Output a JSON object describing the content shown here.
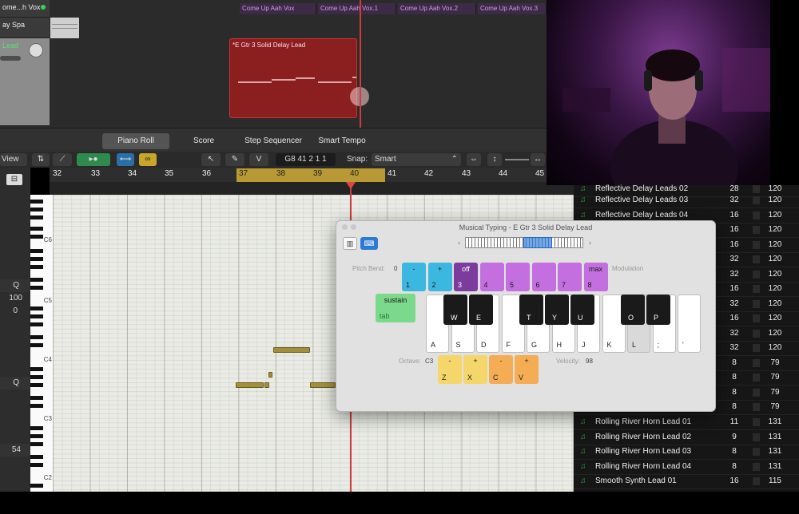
{
  "arrange": {
    "tracks": [
      {
        "name": "ome...h Vox"
      },
      {
        "name": "ay Spa"
      },
      {
        "name": "Lead"
      }
    ],
    "top_regions": [
      {
        "label": "Come Up Aah Vox"
      },
      {
        "label": "Come Up Aah Vox.1"
      },
      {
        "label": "Come Up Aah Vox.2"
      },
      {
        "label": "Come Up Aah Vox.3"
      }
    ],
    "red_region": {
      "label": "*E Gtr 3 Solid Delay Lead"
    }
  },
  "tabs": [
    {
      "label": "Piano Roll"
    },
    {
      "label": "Score"
    },
    {
      "label": "Step Sequencer"
    },
    {
      "label": "Smart Tempo"
    }
  ],
  "toolbar": {
    "view_label": "View",
    "lcd": "G8   41 2 1 1",
    "snap_label": "Snap:",
    "snap_value": "Smart",
    "v_label": "V"
  },
  "ruler": {
    "bars": [
      "32",
      "33",
      "34",
      "35",
      "36",
      "37",
      "38",
      "39",
      "40",
      "41",
      "42",
      "43",
      "44",
      "45"
    ]
  },
  "inspector": {
    "values": [
      "Q",
      "100",
      "0",
      "Q",
      "54"
    ]
  },
  "keyboard": {
    "octaves": [
      "C6",
      "C5",
      "C4",
      "C3",
      "C2"
    ]
  },
  "library": {
    "rows": [
      {
        "name": "Reflective Delay Leads 02",
        "c1": "28",
        "c2": "120"
      },
      {
        "name": "Reflective Delay Leads 03",
        "c1": "32",
        "c2": "120"
      },
      {
        "name": "Reflective Delay Leads 04",
        "c1": "16",
        "c2": "120"
      },
      {
        "name": "",
        "c1": "16",
        "c2": "120"
      },
      {
        "name": "",
        "c1": "16",
        "c2": "120"
      },
      {
        "name": "",
        "c1": "32",
        "c2": "120"
      },
      {
        "name": "",
        "c1": "32",
        "c2": "120"
      },
      {
        "name": "",
        "c1": "16",
        "c2": "120"
      },
      {
        "name": "",
        "c1": "32",
        "c2": "120"
      },
      {
        "name": "",
        "c1": "16",
        "c2": "120"
      },
      {
        "name": "",
        "c1": "32",
        "c2": "120"
      },
      {
        "name": "",
        "c1": "32",
        "c2": "120"
      },
      {
        "name": "",
        "c1": "8",
        "c2": "79"
      },
      {
        "name": "",
        "c1": "8",
        "c2": "79"
      },
      {
        "name": "",
        "c1": "8",
        "c2": "79"
      },
      {
        "name": "",
        "c1": "8",
        "c2": "79"
      },
      {
        "name": "Rolling River Horn Lead 01",
        "c1": "11",
        "c2": "131"
      },
      {
        "name": "Rolling River Horn Lead 02",
        "c1": "9",
        "c2": "131"
      },
      {
        "name": "Rolling River Horn Lead 03",
        "c1": "8",
        "c2": "131"
      },
      {
        "name": "Rolling River Horn Lead 04",
        "c1": "8",
        "c2": "131"
      },
      {
        "name": "Smooth Synth Lead 01",
        "c1": "16",
        "c2": "115"
      }
    ]
  },
  "musical_typing": {
    "title": "Musical Typing - E Gtr 3 Solid Delay Lead",
    "pitch_bend_label": "Pitch Bend:",
    "pitch_bend_value": "0",
    "modulation_label": "Modulation",
    "pitch_keys": [
      {
        "top": "-",
        "bot": "1",
        "color": "#3cb8e0"
      },
      {
        "top": "+",
        "bot": "2",
        "color": "#3cb8e0"
      },
      {
        "top": "off",
        "bot": "3",
        "color": "#7b3c9e"
      },
      {
        "top": "",
        "bot": "4",
        "color": "#c46fe0"
      },
      {
        "top": "",
        "bot": "5",
        "color": "#c46fe0"
      },
      {
        "top": "",
        "bot": "6",
        "color": "#c46fe0"
      },
      {
        "top": "",
        "bot": "7",
        "color": "#c46fe0"
      },
      {
        "top": "max",
        "bot": "8",
        "color": "#c46fe0"
      }
    ],
    "sustain": {
      "top": "sustain",
      "bot": "tab"
    },
    "white_keys": [
      "A",
      "S",
      "D",
      "F",
      "G",
      "H",
      "J",
      "K",
      "L",
      ";",
      "'"
    ],
    "black_keys": [
      "W",
      "E",
      "T",
      "Y",
      "U",
      "O",
      "P"
    ],
    "octave_label": "Octave:",
    "octave_value": "C3",
    "velocity_label": "Velocity:",
    "velocity_value": "98",
    "func_keys": [
      {
        "top": "-",
        "bot": "Z",
        "color": "#f5d66a"
      },
      {
        "top": "+",
        "bot": "X",
        "color": "#f5d66a"
      },
      {
        "top": "-",
        "bot": "C",
        "color": "#f5ad55"
      },
      {
        "top": "+",
        "bot": "V",
        "color": "#f5ad55"
      }
    ]
  }
}
